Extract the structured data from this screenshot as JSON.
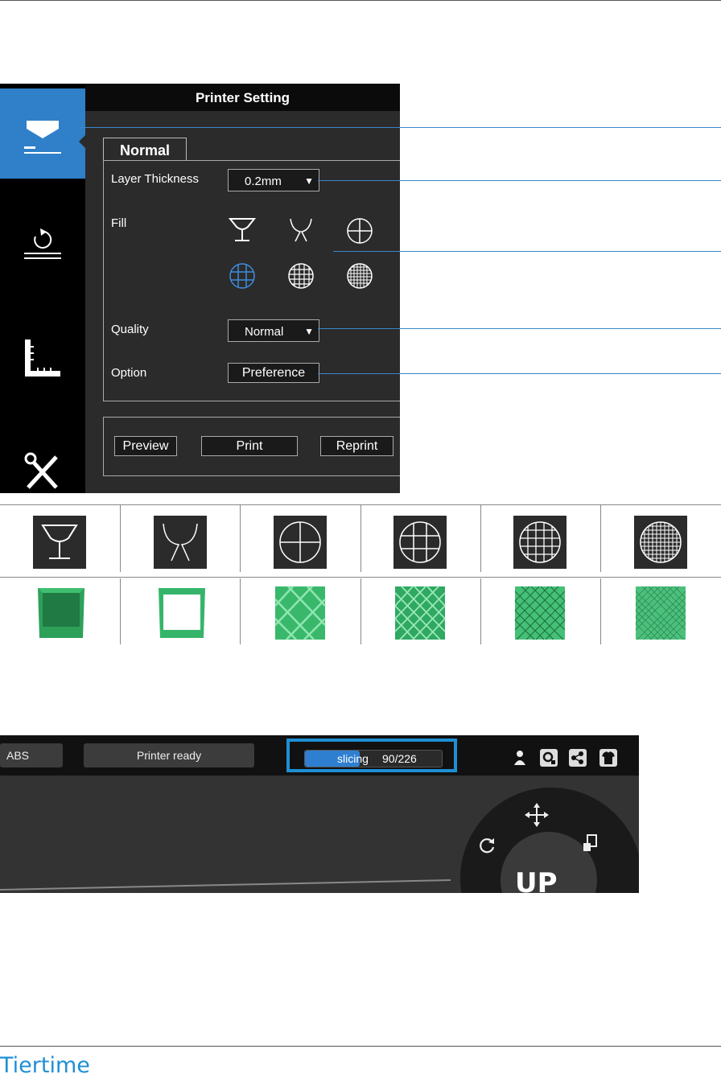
{
  "printer_setting": {
    "title": "Printer Setting",
    "tab": "Normal",
    "layer_thickness": {
      "label": "Layer Thickness",
      "value": "0.2mm"
    },
    "fill": {
      "label": "Fill",
      "options": [
        "shell",
        "surface",
        "large-cell",
        "medium-cell",
        "small-cell",
        "dense-cell"
      ],
      "selected": "medium-cell"
    },
    "quality": {
      "label": "Quality",
      "value": "Normal"
    },
    "option": {
      "label": "Option",
      "button": "Preference"
    },
    "actions": {
      "preview": "Preview",
      "print": "Print",
      "reprint": "Reprint"
    },
    "sidebar_icons": [
      "print-icon",
      "calibrate-icon",
      "measure-icon",
      "maintenance-icon"
    ],
    "accent_color": "#2f80c8"
  },
  "status_bar": {
    "material": "ABS",
    "printer_status": "Printer ready",
    "progress": {
      "label": "slicing",
      "current": "90/226",
      "fraction": 0.398
    },
    "icons": [
      "account-icon",
      "settings-icon",
      "share-icon",
      "shirt-icon"
    ],
    "dial_logo": "UP"
  },
  "brand": "Tiertime"
}
